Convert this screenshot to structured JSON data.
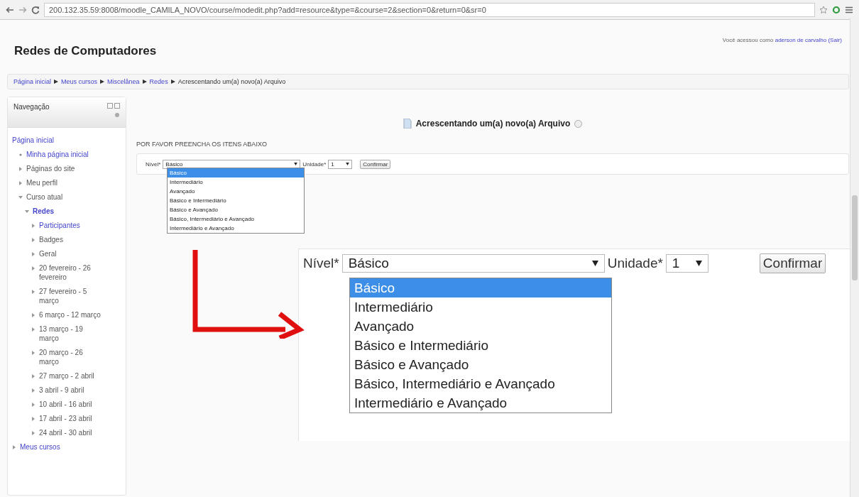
{
  "browser": {
    "url": "200.132.35.59:8008/moodle_CAMILA_NOVO/course/modedit.php?add=resource&type=&course=2&section=0&return=0&sr=0"
  },
  "header": {
    "site_title": "Redes de Computadores",
    "login": {
      "prefix": "Você acessou como",
      "user": "aderson de carvalho",
      "logout": "(Sair)"
    }
  },
  "breadcrumb": [
    {
      "label": "Página inicial",
      "link": true
    },
    {
      "label": "Meus cursos",
      "link": true
    },
    {
      "label": "Miscelânea",
      "link": true
    },
    {
      "label": "Redes",
      "link": true
    },
    {
      "label": "Acrescentando um(a) novo(a) Arquivo",
      "link": false
    }
  ],
  "navigation": {
    "title": "Navegação",
    "items": [
      {
        "label": "Página inicial",
        "kind": "root",
        "link": true,
        "expanded": true,
        "children": [
          {
            "label": "Minha página inicial",
            "kind": "bullet",
            "link": true,
            "expanded": false
          },
          {
            "label": "Páginas do site",
            "kind": "branch",
            "link": false,
            "expanded": false
          },
          {
            "label": "Meu perfil",
            "kind": "branch",
            "link": false,
            "expanded": false
          },
          {
            "label": "Curso atual",
            "kind": "branch",
            "link": false,
            "expanded": true,
            "children": [
              {
                "label": "Redes",
                "kind": "branch",
                "link": true,
                "expanded": true,
                "children": [
                  {
                    "label": "Participantes",
                    "kind": "branch",
                    "link": true,
                    "expanded": false
                  },
                  {
                    "label": "Badges",
                    "kind": "branch",
                    "link": false,
                    "expanded": false
                  },
                  {
                    "label": "Geral",
                    "kind": "branch",
                    "link": false,
                    "expanded": false
                  },
                  {
                    "label": "20 fevereiro - 26 fevereiro",
                    "kind": "branch",
                    "link": false,
                    "expanded": false
                  },
                  {
                    "label": "27 fevereiro - 5 março",
                    "kind": "branch",
                    "link": false,
                    "expanded": false
                  },
                  {
                    "label": "6 março - 12 março",
                    "kind": "branch",
                    "link": false,
                    "expanded": false
                  },
                  {
                    "label": "13 março - 19 março",
                    "kind": "branch",
                    "link": false,
                    "expanded": false
                  },
                  {
                    "label": "20 março - 26 março",
                    "kind": "branch",
                    "link": false,
                    "expanded": false
                  },
                  {
                    "label": "27 março - 2 abril",
                    "kind": "branch",
                    "link": false,
                    "expanded": false
                  },
                  {
                    "label": "3 abril - 9 abril",
                    "kind": "branch",
                    "link": false,
                    "expanded": false
                  },
                  {
                    "label": "10 abril - 16 abril",
                    "kind": "branch",
                    "link": false,
                    "expanded": false
                  },
                  {
                    "label": "17 abril - 23 abril",
                    "kind": "branch",
                    "link": false,
                    "expanded": false
                  },
                  {
                    "label": "24 abril - 30 abril",
                    "kind": "branch",
                    "link": false,
                    "expanded": false
                  }
                ]
              }
            ]
          }
        ]
      },
      {
        "label": "Meus cursos",
        "kind": "branch",
        "link": true,
        "expanded": false
      }
    ]
  },
  "main": {
    "heading": "Acrescentando um(a) novo(a) Arquivo",
    "instructions": "POR FAVOR PREENCHA OS ITENS ABAIXO",
    "form": {
      "level_label": "Nível*",
      "level_value": "Básico",
      "unit_label": "Unidade*",
      "unit_value": "1",
      "confirm": "Confirmar",
      "options": [
        {
          "label": "Básico",
          "selected": true
        },
        {
          "label": "Intermediário",
          "selected": false
        },
        {
          "label": "Avançado",
          "selected": false
        },
        {
          "label": "Básico e Intermediário",
          "selected": false
        },
        {
          "label": "Básico e Avançado",
          "selected": false
        },
        {
          "label": "Básico, Intermediário e Avançado",
          "selected": false
        },
        {
          "label": "Intermediário e Avançado",
          "selected": false
        }
      ]
    },
    "zoom_inset": {
      "level_label": "Nível*",
      "level_value": "Básico",
      "unit_label": "Unidade*",
      "unit_value": "1",
      "confirm": "Confirmar",
      "options": [
        {
          "label": "Básico",
          "selected": true
        },
        {
          "label": "Intermediário",
          "selected": false
        },
        {
          "label": "Avançado",
          "selected": false
        },
        {
          "label": "Básico e Intermediário",
          "selected": false
        },
        {
          "label": "Básico e Avançado",
          "selected": false
        },
        {
          "label": "Básico, Intermediário e Avançado",
          "selected": false
        },
        {
          "label": "Intermediário e Avançado",
          "selected": false
        }
      ]
    }
  }
}
